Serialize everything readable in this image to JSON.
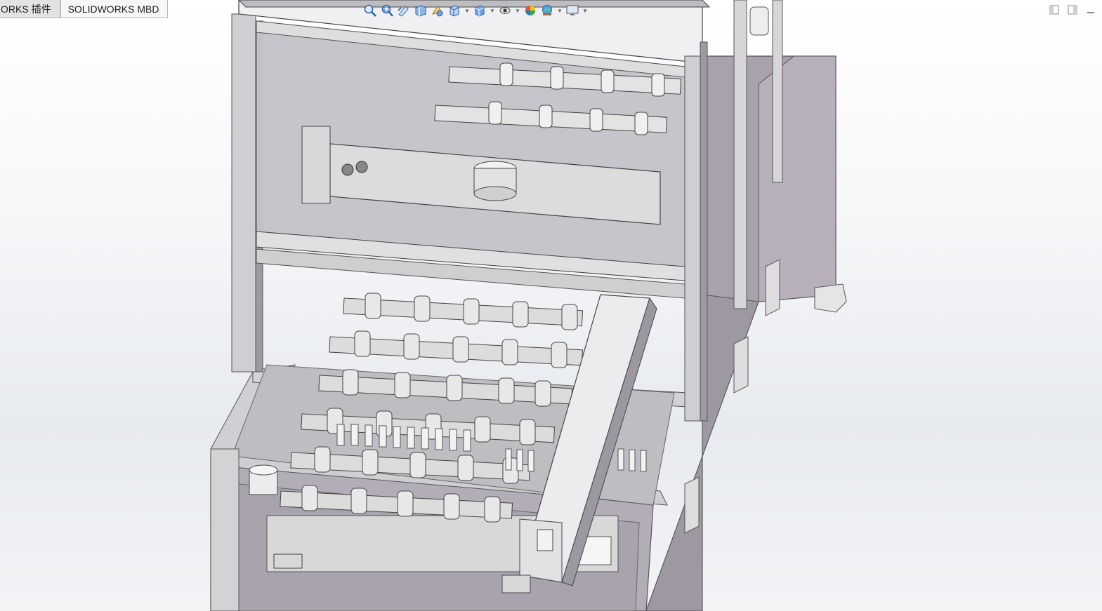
{
  "tabs": [
    {
      "label": "ORKS 插件"
    },
    {
      "label": "SOLIDWORKS MBD"
    }
  ],
  "heads_up_toolbar": {
    "tools": [
      {
        "icon": "zoom-to-fit-icon"
      },
      {
        "icon": "zoom-to-area-icon"
      },
      {
        "icon": "previous-view-icon"
      },
      {
        "icon": "section-view-icon"
      },
      {
        "icon": "dynamic-annotation-views-icon"
      },
      {
        "icon": "view-orientation-icon"
      },
      {
        "icon": "display-style-icon"
      },
      {
        "icon": "hide-show-items-icon"
      },
      {
        "icon": "edit-appearance-icon"
      },
      {
        "icon": "apply-scene-icon"
      },
      {
        "icon": "view-settings-icon"
      }
    ]
  },
  "window_controls": [
    {
      "icon": "tile-left-icon"
    },
    {
      "icon": "tile-right-icon"
    },
    {
      "icon": "minimize-icon"
    }
  ],
  "model": {
    "description_icon": "machine-assembly-3d-model"
  },
  "colors": {
    "frame": "#8c8c92",
    "panel": "#c9c4cc",
    "shade": "#9a97a0",
    "dark": "#606066",
    "bg_top": "#ffffff",
    "bg_mid": "#e7eaef"
  }
}
